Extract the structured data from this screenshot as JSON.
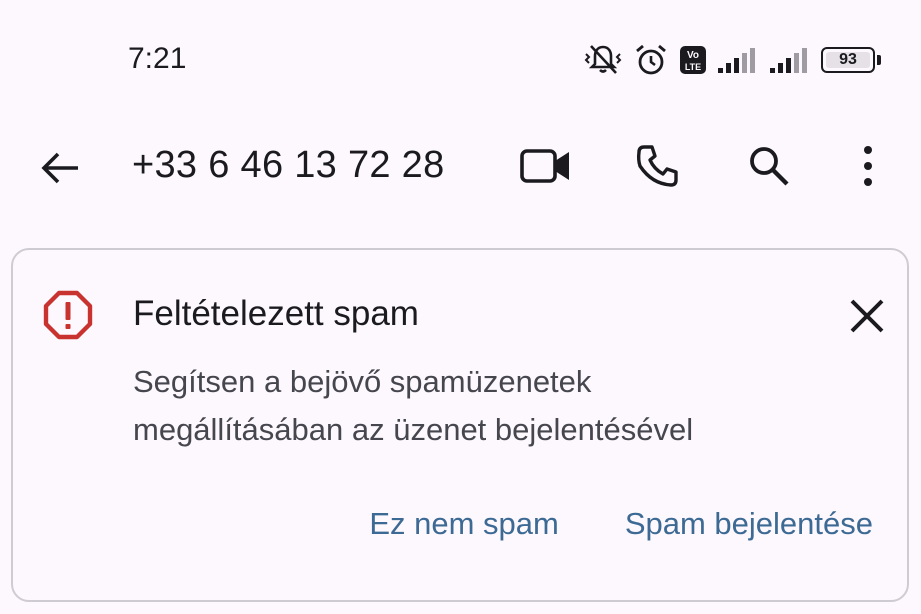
{
  "status_bar": {
    "time": "7:21",
    "battery": "93",
    "network_label": "VoLTE",
    "icons": [
      "vibrate-off-icon",
      "alarm-icon",
      "volte-icon",
      "signal-icon",
      "signal-icon",
      "battery-icon"
    ]
  },
  "app_bar": {
    "title": "+33 6 46 13 72 28",
    "icons": [
      "back-arrow-icon",
      "video-call-icon",
      "phone-icon",
      "search-icon",
      "more-vert-icon"
    ]
  },
  "spam_card": {
    "title": "Feltételezett spam",
    "body_line1": "Segítsen a bejövő spamüzenetek",
    "body_line2": "megállításában az üzenet bejelentésével",
    "action_not_spam": "Ez nem spam",
    "action_report": "Spam bejelentése",
    "icons": [
      "warning-octagon-icon",
      "close-icon"
    ]
  },
  "colors": {
    "background": "#fdf8fd",
    "text_primary": "#1b1b1f",
    "text_secondary": "#46464f",
    "accent": "#3d6a94",
    "warning": "#c8322f",
    "card_border": "#cfcbd3"
  }
}
